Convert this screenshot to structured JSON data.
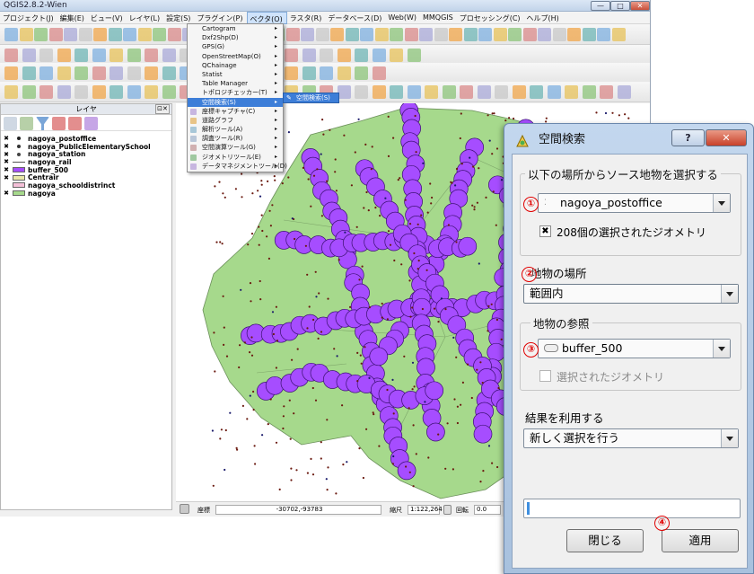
{
  "window": {
    "title": "QGIS2.8.2-Wien",
    "controls": [
      "—",
      "□",
      "✕"
    ]
  },
  "menubar": [
    "プロジェクト(J)",
    "編集(E)",
    "ビュー(V)",
    "レイヤ(L)",
    "設定(S)",
    "プラグイン(P)",
    "ベクタ(O)",
    "ラスタ(R)",
    "データベース(D)",
    "Web(W)",
    "MMQGIS",
    "プロセッシング(C)",
    "ヘルプ(H)"
  ],
  "active_menu": "ベクタ(O)",
  "vector_menu": [
    {
      "label": "Cartogram",
      "sub": true
    },
    {
      "label": "Dxf2Shp(D)",
      "sub": true
    },
    {
      "label": "GPS(G)",
      "sub": true
    },
    {
      "label": "OpenStreetMap(O)",
      "sub": true
    },
    {
      "label": "QChainage",
      "sub": true
    },
    {
      "label": "Statist",
      "sub": true
    },
    {
      "label": "Table Manager",
      "sub": true
    },
    {
      "label": "トポロジチェッカー(T)",
      "sub": true
    },
    {
      "label": "空間検索(S)",
      "sub": true,
      "highlight": true
    },
    {
      "label": "座標キャプチャ(C)",
      "sub": true
    },
    {
      "label": "道路グラフ",
      "sub": true
    },
    {
      "label": "解析ツール(A)",
      "sub": true
    },
    {
      "label": "調査ツール(R)",
      "sub": true
    },
    {
      "label": "空間演算ツール(G)",
      "sub": true
    },
    {
      "label": "ジオメトリツール(E)",
      "sub": true
    },
    {
      "label": "データマネジメントツール(D)",
      "sub": true
    }
  ],
  "submenu_item": "空間検索(S)",
  "layers_panel": {
    "title": "レイヤ",
    "close_glyph": "⊡✕",
    "layers": [
      {
        "name": "nagoya_postoffice",
        "checked": "✖",
        "color": "#222222",
        "kind": "point"
      },
      {
        "name": "nagoya_PublicElementarySchool",
        "checked": "✖",
        "color": "#333333",
        "kind": "point"
      },
      {
        "name": "nagoya_station",
        "checked": "✖",
        "color": "#444444",
        "kind": "point"
      },
      {
        "name": "nagoya_rail",
        "checked": "✖",
        "color": "#555555",
        "kind": "line"
      },
      {
        "name": "buffer_500",
        "checked": "✖",
        "color": "#a64dff",
        "kind": "poly"
      },
      {
        "name": "Centrair",
        "checked": "✖",
        "color": "#e8e8a8",
        "kind": "poly"
      },
      {
        "name": "nagoya_schooldistrinct",
        "checked": "",
        "color": "#f4c0d8",
        "kind": "poly"
      },
      {
        "name": "nagoya",
        "checked": "✖",
        "color": "#a6d98c",
        "kind": "poly"
      }
    ]
  },
  "status": {
    "coord_label": "座標",
    "coord_value": "-30702,-93783",
    "scale_label": "縮尺",
    "scale_value": "1:122,264",
    "rotation_label": "回転",
    "rotation_value": "0.0"
  },
  "dialog": {
    "title": "空間検索",
    "help": "?",
    "close": "✕",
    "source_group": "以下の場所からソース地物を選択する",
    "source_layer": "nagoya_postoffice",
    "selected_geometries": "208個の選択されたジオメトリ",
    "selected_check": "✖",
    "where_label": "地物の場所",
    "where_value": "範囲内",
    "ref_group": "地物の参照",
    "ref_layer": "buffer_500",
    "ref_selected": "選択されたジオメトリ",
    "result_label": "結果を利用する",
    "result_value": "新しく選択を行う",
    "close_button": "閉じる",
    "apply_button": "適用",
    "markers": [
      "①",
      "②",
      "③",
      "④"
    ]
  },
  "colors": {
    "land": "#a6d98c",
    "buffer": "#a64dff",
    "buffer_stroke": "#3a1070",
    "point": "#6b1a10",
    "marker": "#e00000",
    "highlight": "#3d7ed8"
  }
}
